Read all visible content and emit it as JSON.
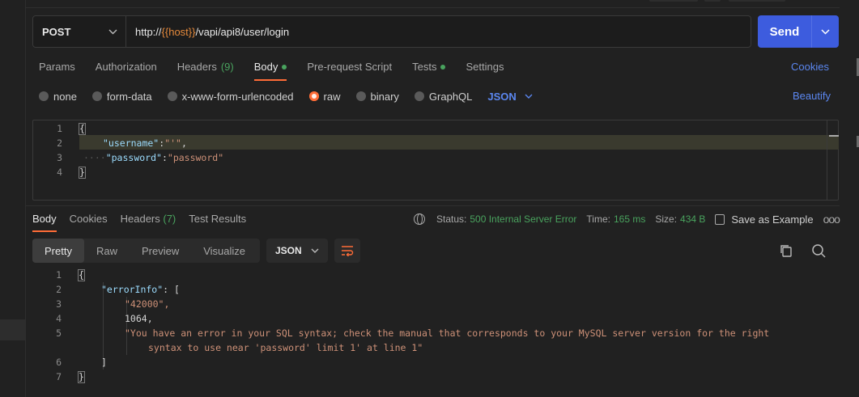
{
  "request": {
    "method": "POST",
    "url_prefix": "http://",
    "url_var": "{{host}}",
    "url_suffix": "/vapi/api8/user/login",
    "send_label": "Send"
  },
  "tabs": {
    "params": "Params",
    "authorization": "Authorization",
    "headers": "Headers",
    "headers_count": "(9)",
    "body": "Body",
    "prerequest": "Pre-request Script",
    "tests": "Tests",
    "settings": "Settings",
    "cookies": "Cookies"
  },
  "body_options": {
    "none": "none",
    "form_data": "form-data",
    "urlencoded": "x-www-form-urlencoded",
    "raw": "raw",
    "binary": "binary",
    "graphql": "GraphQL",
    "format": "JSON",
    "selected": "raw",
    "beautify": "Beautify"
  },
  "request_body": {
    "line_numbers": [
      "1",
      "2",
      "3",
      "4"
    ],
    "open_brace": "{",
    "close_brace": "}",
    "username_key": "\"username\"",
    "username_value": "\"'\"",
    "password_key": "\"password\"",
    "password_value": "\"password\""
  },
  "response": {
    "tabs": {
      "body": "Body",
      "cookies": "Cookies",
      "headers": "Headers",
      "headers_count": "(7)",
      "test_results": "Test Results"
    },
    "status_label": "Status:",
    "status_value": "500 Internal Server Error",
    "time_label": "Time:",
    "time_value": "165 ms",
    "size_label": "Size:",
    "size_value": "434 B",
    "save_example": "Save as Example",
    "more": "ooo",
    "views": {
      "pretty": "Pretty",
      "raw": "Raw",
      "preview": "Preview",
      "visualize": "Visualize"
    },
    "format": "JSON",
    "line_numbers": [
      "1",
      "2",
      "3",
      "4",
      "5",
      "",
      "6",
      "7"
    ],
    "open_brace": "{",
    "close_brace": "}",
    "error_key": "\"errorInfo\"",
    "open_bracket": "[",
    "close_bracket": "]",
    "code": "\"42000\",",
    "errno": "1064,",
    "message_line1": "\"You have an error in your SQL syntax; check the manual that corresponds to your MySQL server version for the right",
    "message_line2": "syntax to use near 'password' limit 1' at line 1\""
  },
  "colors": {
    "accent": "#ff6c37",
    "send": "#3d5cde",
    "link": "#5b87f0",
    "success": "#49a35e"
  }
}
